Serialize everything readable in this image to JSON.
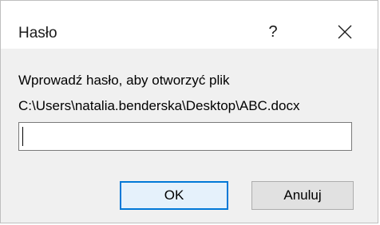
{
  "dialog": {
    "title": "Hasło",
    "help_label": "?",
    "prompt": "Wprowadź hasło, aby otworzyć plik",
    "file_path": "C:\\Users\\natalia.benderska\\Desktop\\ABC.docx",
    "password_value": "",
    "ok_label": "OK",
    "cancel_label": "Anuluj"
  },
  "colors": {
    "content_background": "#f0f0f0",
    "default_button_border": "#0078d7",
    "button_background": "#e1e1e1"
  }
}
